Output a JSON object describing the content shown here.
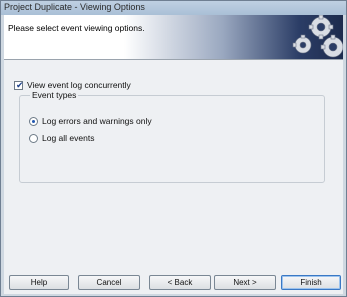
{
  "window": {
    "title": "Project Duplicate - Viewing Options"
  },
  "header": {
    "text": "Please select event viewing options."
  },
  "options": {
    "view_event_log": {
      "label": "View event log concurrently",
      "checked": true
    },
    "event_types": {
      "legend": "Event types",
      "choices": [
        {
          "label": "Log errors and warnings only",
          "selected": true
        },
        {
          "label": "Log all events",
          "selected": false
        }
      ]
    }
  },
  "buttons": {
    "help": "Help",
    "cancel": "Cancel",
    "back": "< Back",
    "next": "Next >",
    "finish": "Finish"
  },
  "icons": {
    "header_art": "gears-icon"
  }
}
